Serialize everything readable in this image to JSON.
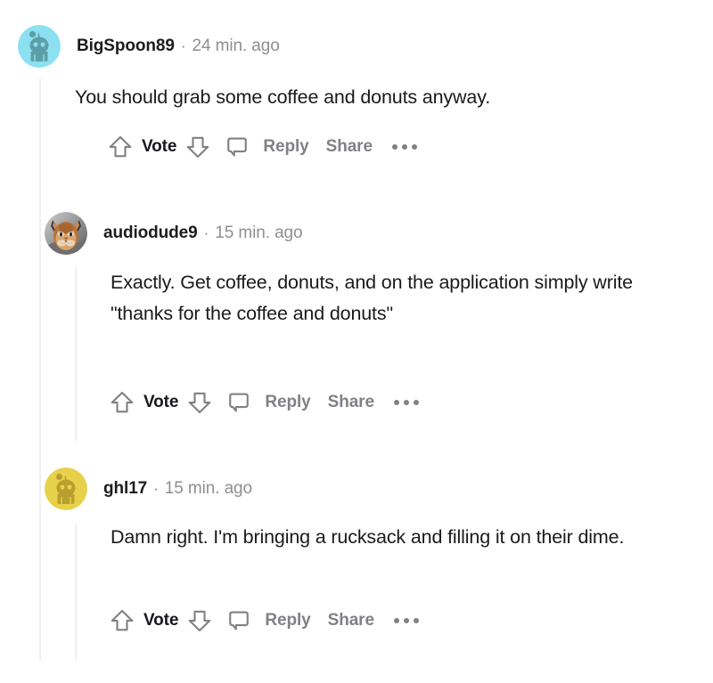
{
  "theme": {
    "background": "#ffffff",
    "text_primary": "#1a1a1b",
    "text_muted": "#8d8f90",
    "action_gray": "#7f8185",
    "thread_line": "#edeff1"
  },
  "actions_labels": {
    "vote": "Vote",
    "reply": "Reply",
    "share": "Share",
    "more": "•••"
  },
  "comments": [
    {
      "id": "c1",
      "depth": 0,
      "username": "BigSpoon89",
      "separator": "·",
      "timestamp": "24 min. ago",
      "body": "You should grab some coffee and donuts anyway.",
      "avatar": {
        "type": "snoo",
        "background": "#8ce0f0",
        "body_color": "#5c9fa8"
      }
    },
    {
      "id": "c2",
      "depth": 1,
      "username": "audiodude9",
      "separator": "·",
      "timestamp": "15 min. ago",
      "body": "Exactly. Get coffee, donuts, and on the application simply write \"thanks for the coffee and donuts\"",
      "avatar": {
        "type": "photo-cat",
        "background": "#8a8a8a",
        "body_color": "#b5743c"
      }
    },
    {
      "id": "c3",
      "depth": 1,
      "username": "ghl17",
      "separator": "·",
      "timestamp": "15 min. ago",
      "body": "Damn right. I'm bringing a rucksack and filling it on their dime.",
      "avatar": {
        "type": "snoo",
        "background": "#e8d14a",
        "body_color": "#b8a02e"
      }
    }
  ]
}
